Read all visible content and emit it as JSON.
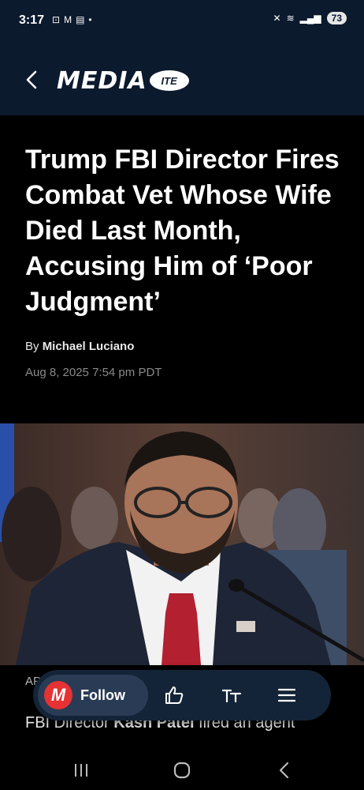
{
  "status_bar": {
    "time": "3:17",
    "left_icons": [
      "screenshot-icon",
      "gmail-icon",
      "news-icon",
      "dot-icon"
    ],
    "right_icons": [
      "mute-icon",
      "wifi-icon",
      "signal-icon"
    ],
    "battery": "73"
  },
  "header": {
    "logo_text": "MEDIA",
    "logo_badge": "ITE"
  },
  "article": {
    "headline": "Trump FBI Director Fires Combat Vet Whose Wife Died Last Month, Accusing Him of ‘Poor Judgment’",
    "byline_prefix": "By",
    "author": "Michael Luciano",
    "date": "Aug 8, 2025 7:54 pm PDT",
    "photo_credit_partial": "AP",
    "body_prefix": "FBI Director",
    "body_name": "Kash Patel",
    "body_suffix": "fired an agent"
  },
  "action_bar": {
    "follow_logo": "M",
    "follow_label": "Follow",
    "icons": [
      "thumbs-up-icon",
      "text-size-icon",
      "menu-icon"
    ]
  },
  "nav_bar": {
    "icons": [
      "recent-apps-icon",
      "home-icon",
      "back-nav-icon"
    ]
  },
  "colors": {
    "header_bg": "#0c1a2e",
    "accent_red": "#e63232",
    "action_bar_bg": "#142438"
  }
}
